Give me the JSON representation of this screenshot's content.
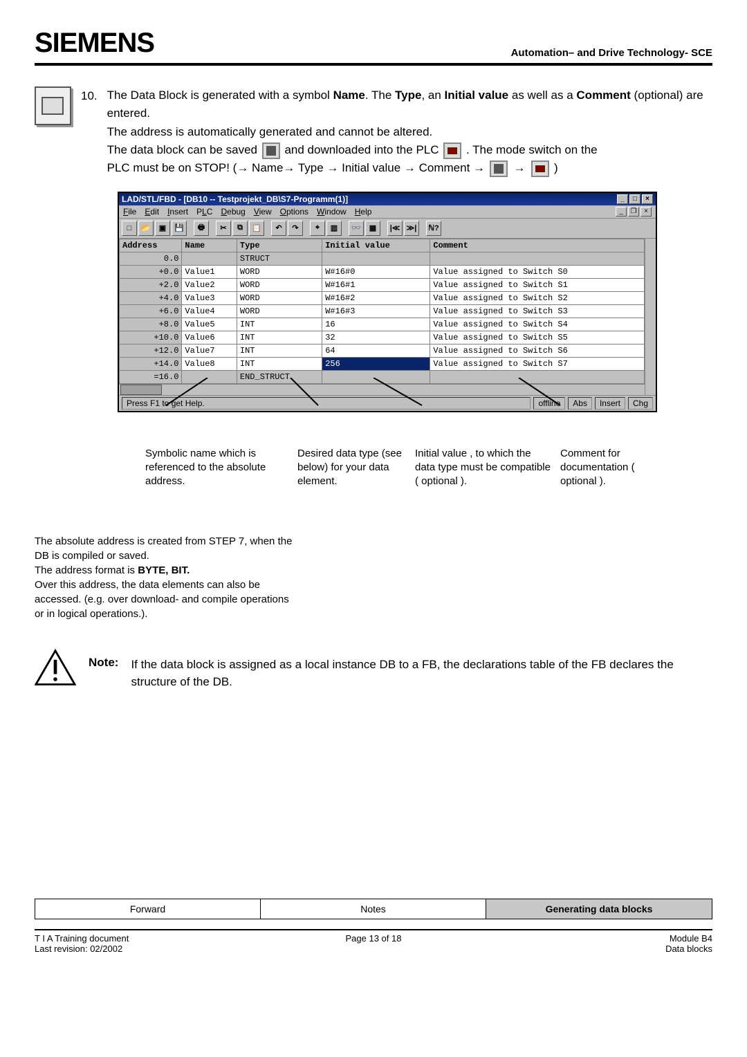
{
  "header": {
    "brand": "SIEMENS",
    "right": "Automation– and Drive Technology- SCE"
  },
  "step": {
    "num": "10.",
    "line1_a": "The Data Block is generated with a symbol ",
    "name_bold": "Name",
    "line1_b": ".  The ",
    "type_bold": "Type",
    "line1_c": ", an ",
    "iv_bold": "Initial value",
    "line1_d": " as well as a ",
    "comment_bold": "Comment",
    "line1_e": " (optional) are entered.",
    "line2": "The address is automatically generated and cannot be altered.",
    "line3_a": "The data block can be saved ",
    "line3_b": " and downloaded into the PLC ",
    "line3_c": ". The mode switch on the",
    "line4_a": "PLC must be on STOP! (→ Name→ Type → Initial value → Comment → ",
    "line4_b": " → ",
    "line4_c": " )"
  },
  "window": {
    "title": "LAD/STL/FBD  - [DB10 -- Testprojekt_DB\\S7-Programm(1)]",
    "menus": [
      "File",
      "Edit",
      "Insert",
      "PLC",
      "Debug",
      "View",
      "Options",
      "Window",
      "Help"
    ],
    "columns": [
      "Address",
      "Name",
      "Type",
      "Initial value",
      "Comment"
    ],
    "rows": [
      {
        "addr": "0.0",
        "name": "",
        "type": "STRUCT",
        "init": "",
        "comment": "",
        "shade": true,
        "shadeName": true,
        "shadeInit": true,
        "shadeComment": true
      },
      {
        "addr": "+0.0",
        "name": "Value1",
        "type": "WORD",
        "init": "W#16#0",
        "comment": "Value assigned to Switch S0"
      },
      {
        "addr": "+2.0",
        "name": "Value2",
        "type": "WORD",
        "init": "W#16#1",
        "comment": "Value assigned to Switch S1"
      },
      {
        "addr": "+4.0",
        "name": "Value3",
        "type": "WORD",
        "init": "W#16#2",
        "comment": "Value assigned to Switch S2"
      },
      {
        "addr": "+6.0",
        "name": "Value4",
        "type": "WORD",
        "init": "W#16#3",
        "comment": "Value assigned to Switch S3"
      },
      {
        "addr": "+8.0",
        "name": "Value5",
        "type": "INT",
        "init": "16",
        "comment": "Value assigned to Switch S4"
      },
      {
        "addr": "+10.0",
        "name": "Value6",
        "type": "INT",
        "init": "32",
        "comment": "Value assigned to Switch S5"
      },
      {
        "addr": "+12.0",
        "name": "Value7",
        "type": "INT",
        "init": "64",
        "comment": "Value assigned to Switch S6"
      },
      {
        "addr": "+14.0",
        "name": "Value8",
        "type": "INT",
        "init": "256",
        "comment": "Value assigned to Switch S7",
        "selInit": true
      },
      {
        "addr": "=16.0",
        "name": "",
        "type": "END_STRUCT",
        "init": "",
        "comment": "",
        "shade": true,
        "shadeName": true,
        "shadeInit": true,
        "shadeComment": true
      }
    ],
    "status_help": "Press F1 to get Help.",
    "status_offline": "offline",
    "status_abs": "Abs",
    "status_mode": "Insert",
    "status_chg": "Chg"
  },
  "callouts": {
    "c1": "Symbolic name which is referenced to the absolute address.",
    "c2": "Desired  data type (see below) for your data element.",
    "c3": "Initial value , to which the data type must be compatible ( optional ).",
    "c4": "Comment for documentation ( optional )."
  },
  "below": {
    "p1": "The absolute address is created from STEP 7, when the DB is compiled or saved.",
    "p2a": "The address format is ",
    "p2b_bold": "BYTE, BIT.",
    "p3": "Over this address, the data elements can also be accessed.  (e.g. over download- and compile operations or in logical operations.)."
  },
  "note": {
    "label": "Note:",
    "text": "If the data block is assigned as a local instance DB to a FB, the declarations table of the FB declares the structure of the DB."
  },
  "footernav": {
    "a": "Forward",
    "b": "Notes",
    "c": "Generating data blocks"
  },
  "footer": {
    "l1": "T I A  Training document",
    "l2": "Last revision: 02/2002",
    "c": "Page 13 of 18",
    "r1": "Module B4",
    "r2": "Data blocks"
  }
}
